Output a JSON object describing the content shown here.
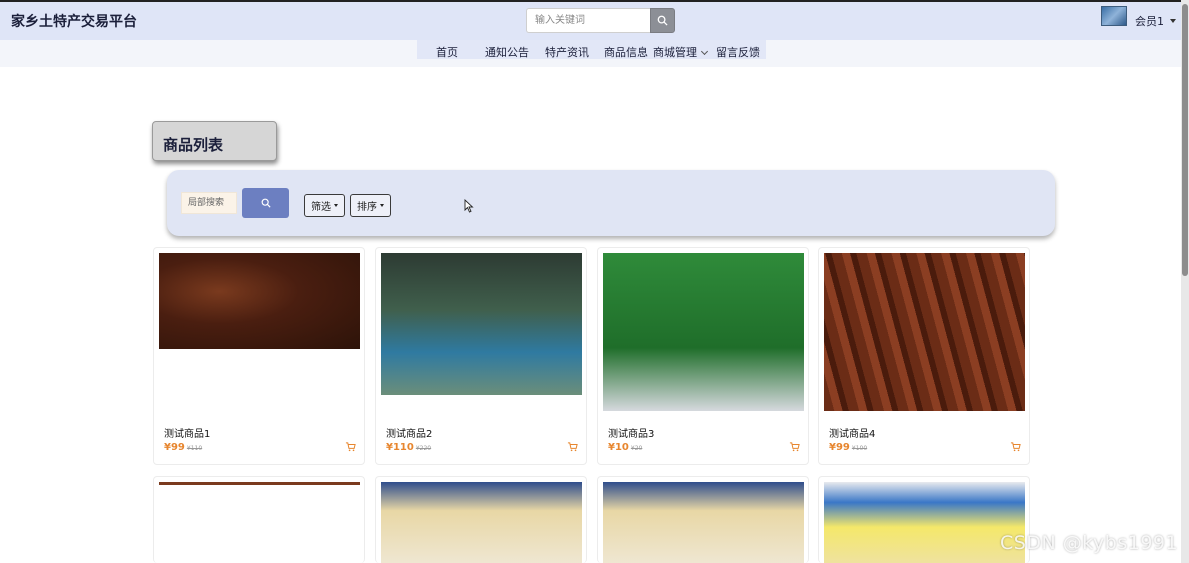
{
  "header": {
    "site_title": "家乡土特产交易平台",
    "search_placeholder": "输入关键词",
    "user_label": "会员1"
  },
  "nav": {
    "items": [
      {
        "label": "首页"
      },
      {
        "label": "通知公告"
      },
      {
        "label": "特产资讯"
      },
      {
        "label": "商品信息"
      },
      {
        "label": "商城管理"
      },
      {
        "label": "留言反馈"
      }
    ]
  },
  "section": {
    "title": "商品列表"
  },
  "filters": {
    "local_search_placeholder": "局部搜索",
    "filter_label": "筛选",
    "sort_label": "排序"
  },
  "products": [
    {
      "name": "测试商品1",
      "price": "¥99",
      "old_price": "¥110",
      "image": "beef-jerky-photo"
    },
    {
      "name": "测试商品2",
      "price": "¥110",
      "old_price": "¥220",
      "image": "packaged-beef-photo"
    },
    {
      "name": "测试商品3",
      "price": "¥10",
      "old_price": "¥20",
      "image": "green-beef-package-photo"
    },
    {
      "name": "测试商品4",
      "price": "¥99",
      "old_price": "¥100",
      "image": "beef-strips-photo"
    }
  ],
  "watermark": "CSDN @kybs1991",
  "colors": {
    "header_bg": "#dfe5f7",
    "accent_button": "#6c7fc1",
    "price": "#e7862f"
  }
}
